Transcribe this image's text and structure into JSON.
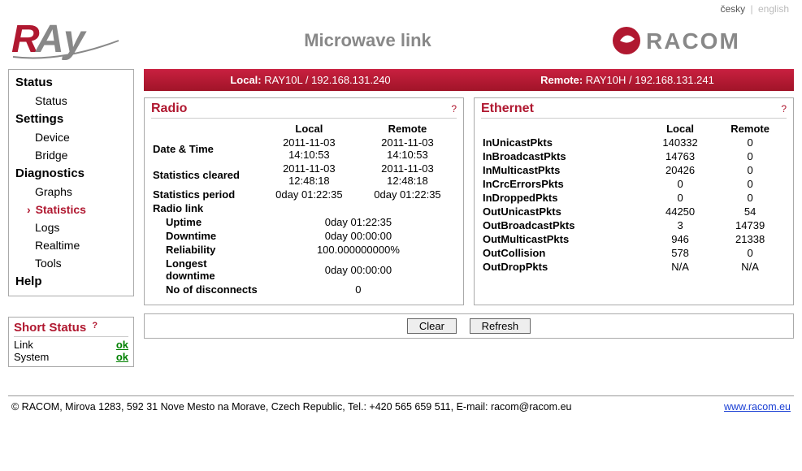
{
  "lang": {
    "cs": "česky",
    "en": "english"
  },
  "header": {
    "title": "Microwave link"
  },
  "nav": {
    "status_head": "Status",
    "status_item": "Status",
    "settings_head": "Settings",
    "device": "Device",
    "bridge": "Bridge",
    "diag_head": "Diagnostics",
    "graphs": "Graphs",
    "statistics": "Statistics",
    "logs": "Logs",
    "realtime": "Realtime",
    "tools": "Tools",
    "help_head": "Help"
  },
  "short_status": {
    "title": "Short Status",
    "link_label": "Link",
    "link_value": "ok",
    "system_label": "System",
    "system_value": "ok"
  },
  "conn": {
    "local_label": "Local:",
    "local_value": "RAY10L / 192.168.131.240",
    "remote_label": "Remote:",
    "remote_value": "RAY10H / 192.168.131.241"
  },
  "radio": {
    "title": "Radio",
    "col_local": "Local",
    "col_remote": "Remote",
    "date_time_label": "Date & Time",
    "date_time_local": "2011-11-03 14:10:53",
    "date_time_remote": "2011-11-03 14:10:53",
    "cleared_label": "Statistics cleared",
    "cleared_local": "2011-11-03 12:48:18",
    "cleared_remote": "2011-11-03 12:48:18",
    "period_label": "Statistics period",
    "period_local": "0day 01:22:35",
    "period_remote": "0day 01:22:35",
    "link_label": "Radio link",
    "uptime_label": "Uptime",
    "uptime_value": "0day 01:22:35",
    "downtime_label": "Downtime",
    "downtime_value": "0day 00:00:00",
    "reliability_label": "Reliability",
    "reliability_value": "100.000000000%",
    "longest_label": "Longest downtime",
    "longest_value": "0day 00:00:00",
    "disc_label": "No of disconnects",
    "disc_value": "0"
  },
  "eth": {
    "title": "Ethernet",
    "col_local": "Local",
    "col_remote": "Remote",
    "rows": [
      {
        "label": "InUnicastPkts",
        "local": "140332",
        "remote": "0"
      },
      {
        "label": "InBroadcastPkts",
        "local": "14763",
        "remote": "0"
      },
      {
        "label": "InMulticastPkts",
        "local": "20426",
        "remote": "0"
      },
      {
        "label": "InCrcErrorsPkts",
        "local": "0",
        "remote": "0"
      },
      {
        "label": "InDroppedPkts",
        "local": "0",
        "remote": "0"
      },
      {
        "label": "OutUnicastPkts",
        "local": "44250",
        "remote": "54"
      },
      {
        "label": "OutBroadcastPkts",
        "local": "3",
        "remote": "14739"
      },
      {
        "label": "OutMulticastPkts",
        "local": "946",
        "remote": "21338"
      },
      {
        "label": "OutCollision",
        "local": "578",
        "remote": "0"
      },
      {
        "label": "OutDropPkts",
        "local": "N/A",
        "remote": "N/A"
      }
    ]
  },
  "buttons": {
    "clear": "Clear",
    "refresh": "Refresh"
  },
  "footer": {
    "text": "© RACOM, Mirova 1283, 592 31 Nove Mesto na Morave, Czech Republic, Tel.: +420 565 659 511, E-mail: racom@racom.eu",
    "link": "www.racom.eu"
  }
}
